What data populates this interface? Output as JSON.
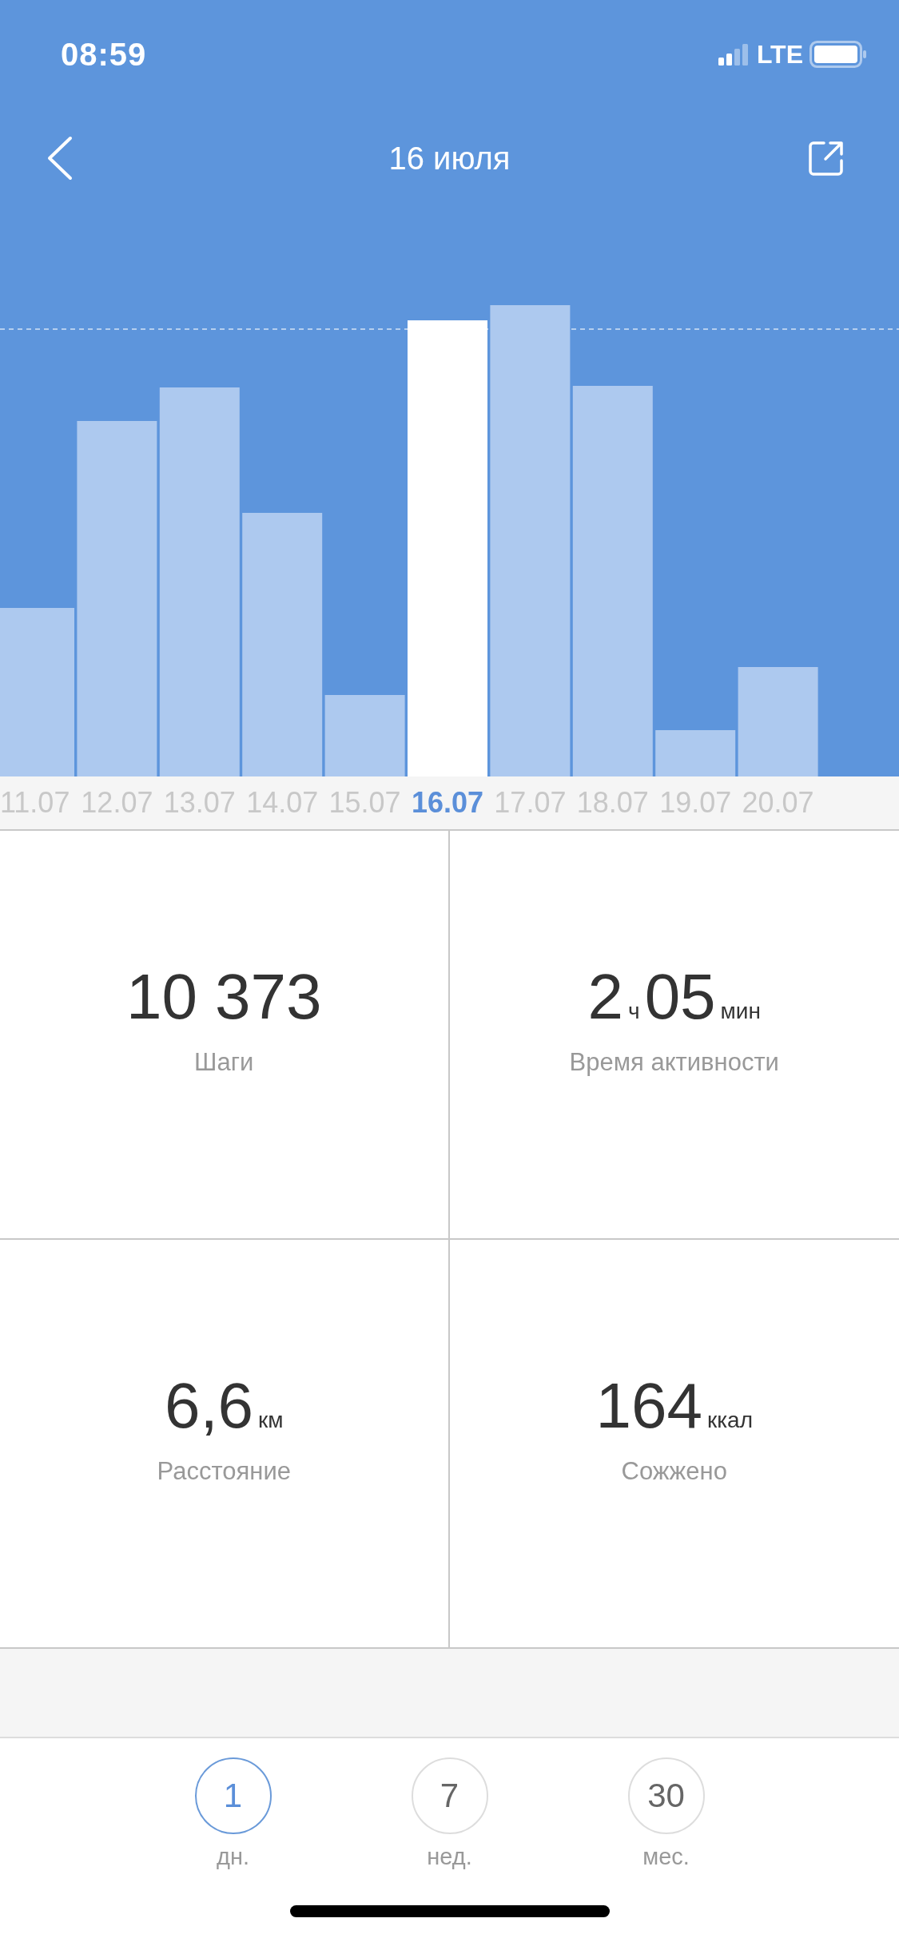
{
  "status_bar": {
    "time": "08:59",
    "network": "LTE"
  },
  "header": {
    "title": "16 июля"
  },
  "chart": {
    "dates": [
      {
        "label": "11.07",
        "selected": false
      },
      {
        "label": "12.07",
        "selected": false
      },
      {
        "label": "13.07",
        "selected": false
      },
      {
        "label": "14.07",
        "selected": false
      },
      {
        "label": "15.07",
        "selected": false
      },
      {
        "label": "16.07",
        "selected": true
      },
      {
        "label": "17.07",
        "selected": false
      },
      {
        "label": "18.07",
        "selected": false
      },
      {
        "label": "19.07",
        "selected": false
      },
      {
        "label": "20.07",
        "selected": false
      }
    ]
  },
  "stats": [
    {
      "parts": [
        {
          "kind": "number",
          "text": "10 373"
        }
      ],
      "label": "Шаги"
    },
    {
      "parts": [
        {
          "kind": "number",
          "text": "2"
        },
        {
          "kind": "unit",
          "text": "ч"
        },
        {
          "kind": "number",
          "text": "05"
        },
        {
          "kind": "unit",
          "text": "мин"
        }
      ],
      "label": "Время активности"
    },
    {
      "parts": [
        {
          "kind": "number",
          "text": "6,6"
        },
        {
          "kind": "unit",
          "text": "км"
        }
      ],
      "label": "Расстояние"
    },
    {
      "parts": [
        {
          "kind": "number",
          "text": "164"
        },
        {
          "kind": "unit",
          "text": "ккал"
        }
      ],
      "label": "Сожжено"
    }
  ],
  "periods": [
    {
      "number": "1",
      "label": "дн.",
      "selected": true
    },
    {
      "number": "7",
      "label": "нед.",
      "selected": false
    },
    {
      "number": "30",
      "label": "мес.",
      "selected": false
    }
  ]
}
